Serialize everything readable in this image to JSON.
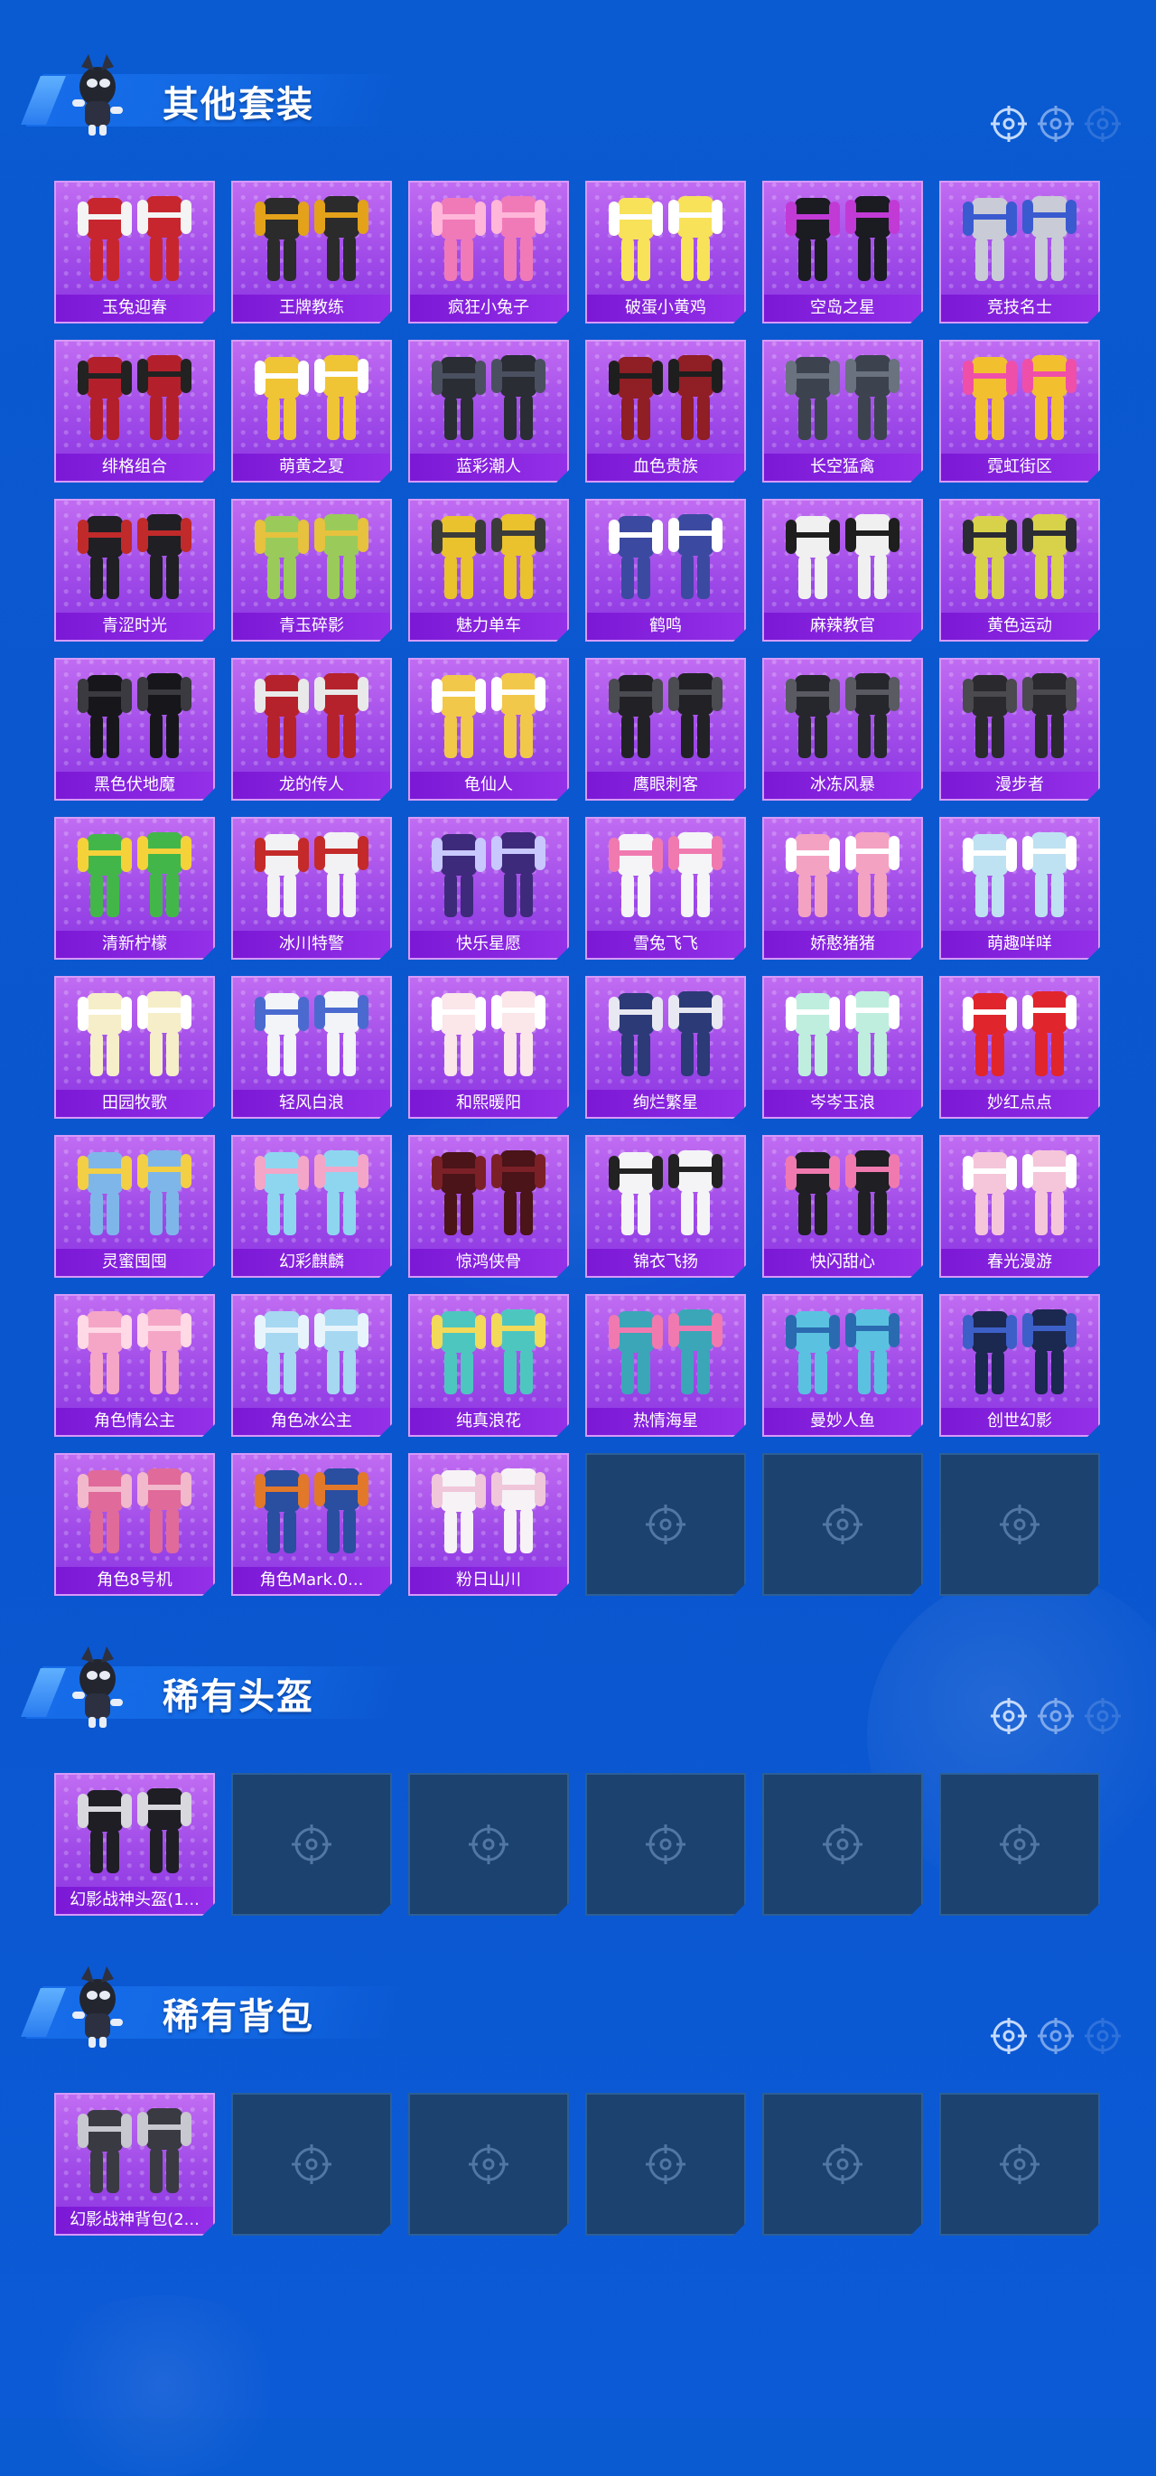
{
  "colors": {
    "background": "#0b57cf",
    "card_fill": "#a44ee9",
    "card_label_bg": "#8621de",
    "empty_card": "#1c426f"
  },
  "sections": [
    {
      "id": "other-outfits",
      "title": "其他套装",
      "items": [
        {
          "label": "玉兔迎春",
          "icon": "outfit-red-icon",
          "palette": [
            "#c8262e",
            "#f4f4f4"
          ]
        },
        {
          "label": "王牌教练",
          "icon": "outfit-black-yellow-icon",
          "palette": [
            "#2b2b2b",
            "#e3a21a"
          ]
        },
        {
          "label": "疯狂小兔子",
          "icon": "outfit-pink-bunny-icon",
          "palette": [
            "#f07ab8",
            "#ffb6d9"
          ]
        },
        {
          "label": "破蛋小黄鸡",
          "icon": "outfit-yellow-chick-icon",
          "palette": [
            "#f7e25a",
            "#ffffff"
          ]
        },
        {
          "label": "空岛之星",
          "icon": "outfit-black-icon",
          "palette": [
            "#1b1b22",
            "#c23ad6"
          ]
        },
        {
          "label": "竞技名士",
          "icon": "outfit-grey-icon",
          "palette": [
            "#c9ccd6",
            "#3a5ad0"
          ]
        },
        {
          "label": "绯格组合",
          "icon": "outfit-red-black-icon",
          "palette": [
            "#b3202b",
            "#222222"
          ]
        },
        {
          "label": "萌黄之夏",
          "icon": "outfit-yellow-icon",
          "palette": [
            "#f0c535",
            "#ffffff"
          ]
        },
        {
          "label": "蓝彩潮人",
          "icon": "outfit-black-icon",
          "palette": [
            "#2a2d34",
            "#4a5060"
          ]
        },
        {
          "label": "血色贵族",
          "icon": "outfit-red-black-icon",
          "palette": [
            "#8f1e25",
            "#1e1e1e"
          ]
        },
        {
          "label": "长空猛禽",
          "icon": "outfit-camo-icon",
          "palette": [
            "#3c434f",
            "#6a7280"
          ]
        },
        {
          "label": "霓虹街区",
          "icon": "outfit-neon-icon",
          "palette": [
            "#f2c02f",
            "#ef4fa9"
          ]
        },
        {
          "label": "青涩时光",
          "icon": "outfit-black-red-icon",
          "palette": [
            "#1f1f24",
            "#c02a2a"
          ]
        },
        {
          "label": "青玉碎影",
          "icon": "outfit-green-icon",
          "palette": [
            "#9acb5a",
            "#e6c23e"
          ]
        },
        {
          "label": "魅力单车",
          "icon": "outfit-yellow-icon",
          "palette": [
            "#e9c22d",
            "#3b3b3b"
          ]
        },
        {
          "label": "鹤鸣",
          "icon": "outfit-hoodie-icon",
          "palette": [
            "#3b4aa0",
            "#ffffff"
          ]
        },
        {
          "label": "麻辣教官",
          "icon": "outfit-white-black-icon",
          "palette": [
            "#f0f0f0",
            "#1e1e1e"
          ]
        },
        {
          "label": "黄色运动",
          "icon": "outfit-yellow-jacket-icon",
          "palette": [
            "#d8d24a",
            "#2b2b33"
          ]
        },
        {
          "label": "黑色伏地魔",
          "icon": "outfit-black-hood-icon",
          "palette": [
            "#17171b",
            "#3a3a40"
          ]
        },
        {
          "label": "龙的传人",
          "icon": "outfit-red-dress-icon",
          "palette": [
            "#b5222c",
            "#e9e9e9"
          ]
        },
        {
          "label": "龟仙人",
          "icon": "outfit-shirt-icon",
          "palette": [
            "#f2c84a",
            "#ffffff"
          ]
        },
        {
          "label": "鹰眼刺客",
          "icon": "outfit-black-icon",
          "palette": [
            "#222226",
            "#4b4b52"
          ]
        },
        {
          "label": "冰冻风暴",
          "icon": "outfit-black-icon",
          "palette": [
            "#26272c",
            "#595a62"
          ]
        },
        {
          "label": "漫步者",
          "icon": "outfit-black-icon",
          "palette": [
            "#2a2a2e",
            "#4a4a4f"
          ]
        },
        {
          "label": "清新柠檬",
          "icon": "outfit-green-jacket-icon",
          "palette": [
            "#43b64a",
            "#f5d23a"
          ]
        },
        {
          "label": "冰川特警",
          "icon": "outfit-white-icon",
          "palette": [
            "#f2f2f4",
            "#c42a2a"
          ]
        },
        {
          "label": "快乐星愿",
          "icon": "outfit-mecha-icon",
          "palette": [
            "#3e2a7a",
            "#c8c8ff"
          ]
        },
        {
          "label": "雪兔飞飞",
          "icon": "outfit-white-pink-icon",
          "palette": [
            "#f5f5f8",
            "#f07ab0"
          ]
        },
        {
          "label": "娇憨猪猪",
          "icon": "outfit-pink-icon",
          "palette": [
            "#f4a2c2",
            "#ffffff"
          ]
        },
        {
          "label": "萌趣咩咩",
          "icon": "outfit-light-blue-icon",
          "palette": [
            "#bfe2f2",
            "#ffffff"
          ]
        },
        {
          "label": "田园牧歌",
          "icon": "outfit-cream-icon",
          "palette": [
            "#f6eec8",
            "#ffffff"
          ]
        },
        {
          "label": "轻风白浪",
          "icon": "outfit-white-blue-icon",
          "palette": [
            "#f2f4f8",
            "#4a6ad0"
          ]
        },
        {
          "label": "和熙暖阳",
          "icon": "outfit-white-pink-icon",
          "palette": [
            "#fbe6ea",
            "#ffffff"
          ]
        },
        {
          "label": "绚烂繁星",
          "icon": "outfit-navy-white-icon",
          "palette": [
            "#2c3a78",
            "#e8e8f2"
          ]
        },
        {
          "label": "岑岑玉浪",
          "icon": "outfit-mint-icon",
          "palette": [
            "#bfeede",
            "#ffffff"
          ]
        },
        {
          "label": "妙红点点",
          "icon": "outfit-red-dress-icon",
          "palette": [
            "#e0262c",
            "#ffffff"
          ]
        },
        {
          "label": "灵蜜囤囤",
          "icon": "outfit-blue-yellow-icon",
          "palette": [
            "#7fb6ea",
            "#f3cf46"
          ]
        },
        {
          "label": "幻彩麒麟",
          "icon": "outfit-pastel-icon",
          "palette": [
            "#8ed6f0",
            "#f4a6c8"
          ]
        },
        {
          "label": "惊鸿侠骨",
          "icon": "outfit-dark-red-icon",
          "palette": [
            "#4a1418",
            "#7c2028"
          ]
        },
        {
          "label": "锦衣飞扬",
          "icon": "outfit-white-robe-icon",
          "palette": [
            "#f4f4f6",
            "#222222"
          ]
        },
        {
          "label": "快闪甜心",
          "icon": "outfit-black-pink-icon",
          "palette": [
            "#1f1f24",
            "#f07ab0"
          ]
        },
        {
          "label": "春光漫游",
          "icon": "outfit-pink-icon",
          "palette": [
            "#f5c6da",
            "#ffffff"
          ]
        },
        {
          "label": "角色情公主",
          "icon": "character-pink-icon",
          "palette": [
            "#f5a6c6",
            "#ffd9e6"
          ]
        },
        {
          "label": "角色冰公主",
          "icon": "character-blue-icon",
          "palette": [
            "#a6d8f2",
            "#e8f4fb"
          ]
        },
        {
          "label": "纯真浪花",
          "icon": "outfit-teal-yellow-icon",
          "palette": [
            "#4ec6c0",
            "#f2d95a"
          ]
        },
        {
          "label": "热情海星",
          "icon": "outfit-teal-icon",
          "palette": [
            "#3ba6b8",
            "#f07ab0"
          ]
        },
        {
          "label": "曼妙人鱼",
          "icon": "outfit-aqua-icon",
          "palette": [
            "#5ac2e0",
            "#2a6ab0"
          ]
        },
        {
          "label": "创世幻影",
          "icon": "outfit-dark-blue-icon",
          "palette": [
            "#1b2850",
            "#3c60c8"
          ]
        },
        {
          "label": "角色8号机",
          "icon": "character-mecha-pink-icon",
          "palette": [
            "#e06a9a",
            "#f2b8cc"
          ]
        },
        {
          "label": "角色Mark.0...",
          "icon": "character-mecha-blue-icon",
          "palette": [
            "#2a4ea0",
            "#e2782a"
          ]
        },
        {
          "label": "粉日山川",
          "icon": "outfit-white-robe-icon",
          "palette": [
            "#f6f2f6",
            "#f0c6da"
          ]
        }
      ],
      "empty_slots": 3
    },
    {
      "id": "rare-helmets",
      "title": "稀有头盔",
      "items": [
        {
          "label": "幻影战神头盔(1...",
          "icon": "helmet-icon",
          "palette": [
            "#1e1e24",
            "#d8d8de"
          ]
        }
      ],
      "empty_slots": 5
    },
    {
      "id": "rare-backpacks",
      "title": "稀有背包",
      "items": [
        {
          "label": "幻影战神背包(2...",
          "icon": "backpack-icon",
          "palette": [
            "#3a3a42",
            "#c8c8d0"
          ]
        }
      ],
      "empty_slots": 5
    }
  ]
}
